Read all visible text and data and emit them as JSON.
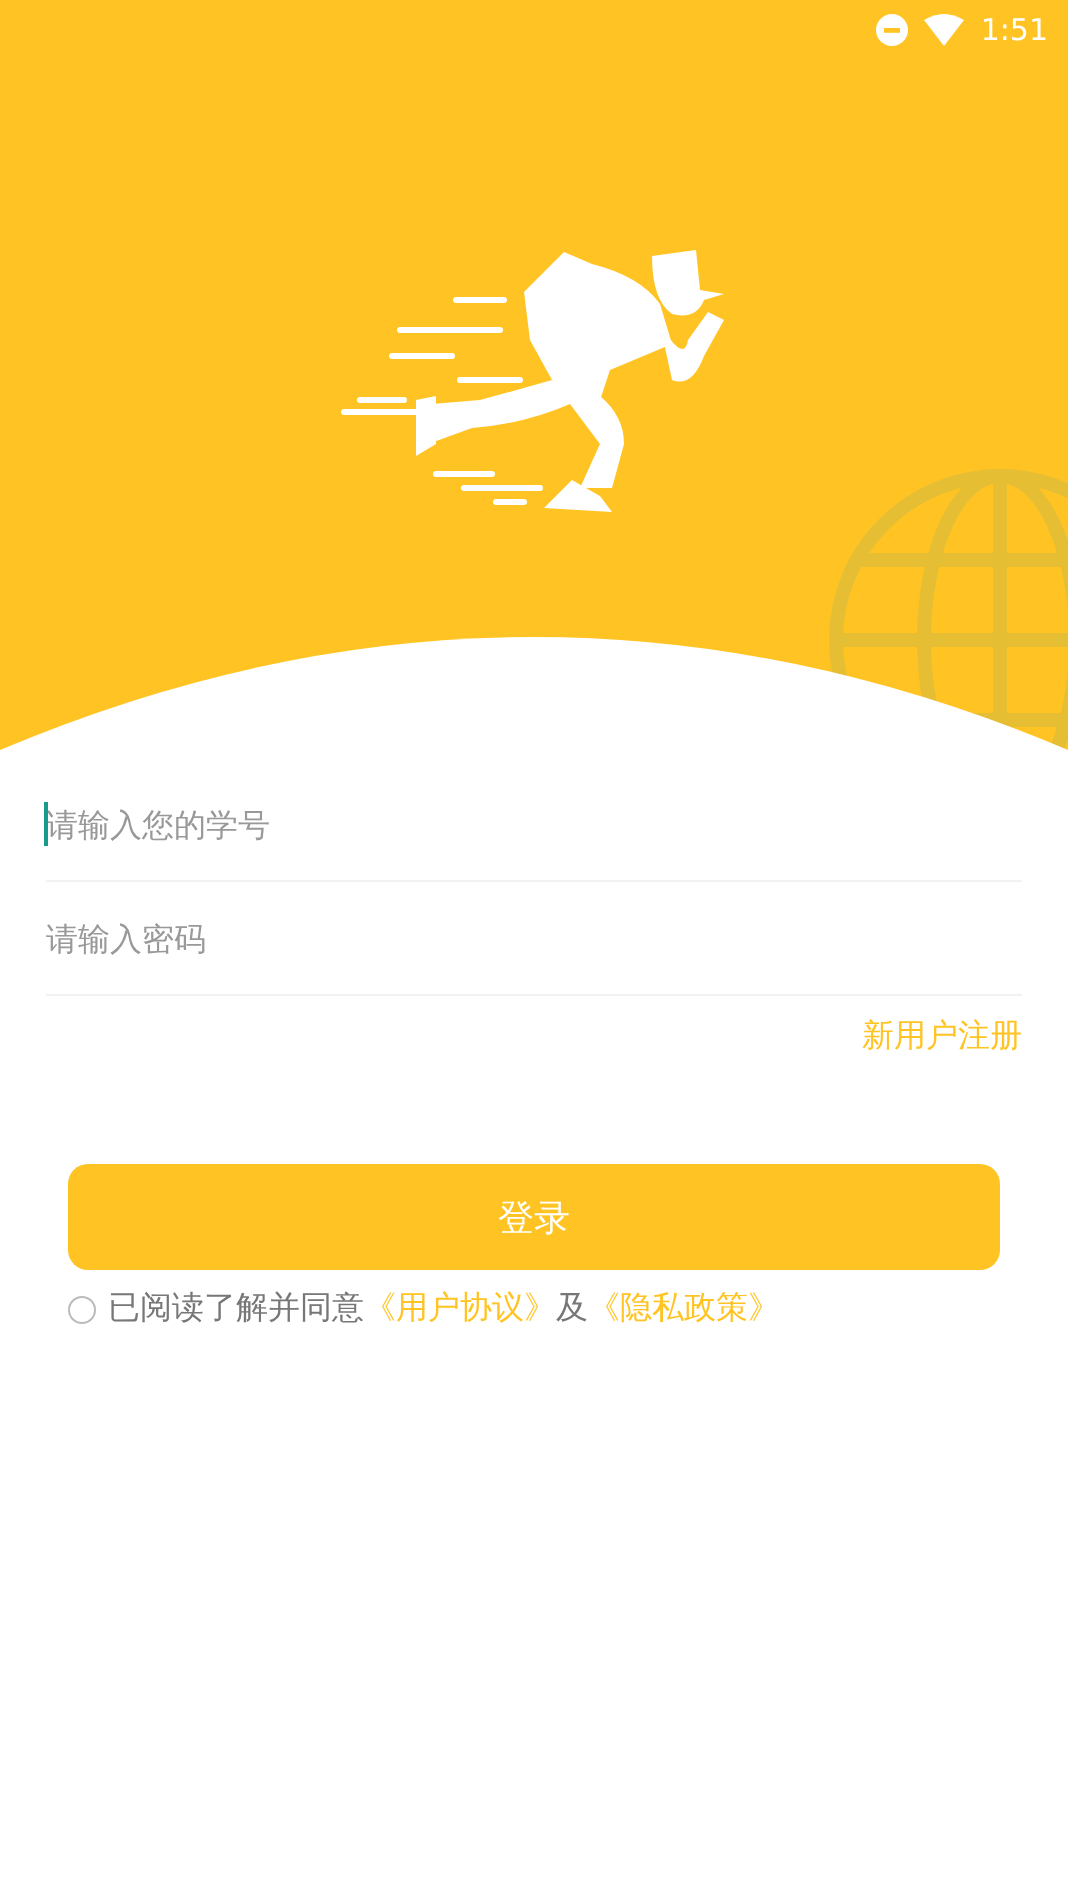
{
  "status_bar": {
    "time": "1:51"
  },
  "fields": [
    {
      "placeholder": "请输入您的学号",
      "focused": true
    },
    {
      "placeholder": "请输入密码",
      "focused": false
    }
  ],
  "register_link": "新用户注册",
  "login_button": "登录",
  "agreement": {
    "checked": false,
    "parts": [
      {
        "kind": "text",
        "text": "已阅读了解并同意"
      },
      {
        "kind": "link",
        "text": "《用户协议》"
      },
      {
        "kind": "text",
        "text": "及"
      },
      {
        "kind": "link",
        "text": "《隐私政策》"
      }
    ]
  }
}
